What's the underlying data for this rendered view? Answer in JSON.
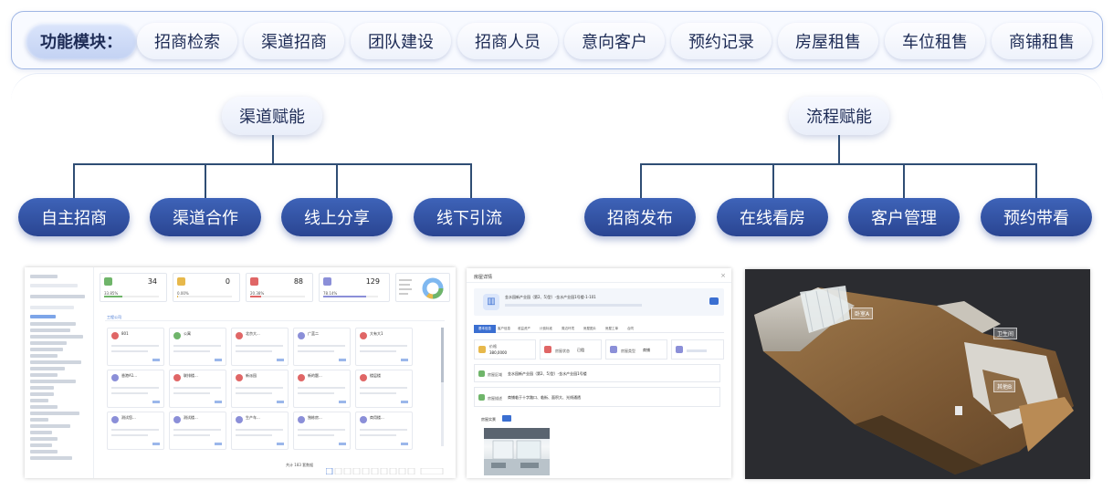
{
  "topbar": {
    "label": "功能模块：",
    "modules": [
      "招商检索",
      "渠道招商",
      "团队建设",
      "招商人员",
      "意向客户",
      "预约记录",
      "房屋租售",
      "车位租售",
      "商铺租售"
    ]
  },
  "groups": [
    {
      "title": "渠道赋能",
      "items": [
        "自主招商",
        "渠道合作",
        "线上分享",
        "线下引流"
      ]
    },
    {
      "title": "流程赋能",
      "items": [
        "招商发布",
        "在线看房",
        "客户管理",
        "预约带看"
      ]
    }
  ],
  "colors": {
    "accent": "#2f4e9e",
    "accent_light": "#3e63b8",
    "border": "#9fb6e4",
    "line": "#2f4d74"
  },
  "screenshot_left": {
    "stats": [
      {
        "value": "34",
        "pct": "33.85%",
        "color": "#6fb56a"
      },
      {
        "value": "0",
        "pct": "0.00%",
        "color": "#e7b84b"
      },
      {
        "value": "88",
        "pct": "20.38%",
        "color": "#e06666"
      },
      {
        "value": "129",
        "pct": "78.14%",
        "color": "#8b8fd8"
      }
    ],
    "section_title": "工程公司",
    "cards": [
      "801",
      "公寓",
      "北京大...",
      "广蓝二",
      "大有大1",
      "香港A1...",
      "联排楼...",
      "新派园",
      "新的题...",
      "楼层楼",
      "测试您...",
      "测试楼...",
      "生产车...",
      "独栋房...",
      "商用楼..."
    ],
    "footer_text": "共计 183 套数据"
  },
  "screenshot_mid": {
    "title": "房屋详情",
    "address": "金水园新产业园（第2、5)型）-金水产业园1号楼-1-101",
    "tabs": [
      "基本信息",
      "客户信息",
      "收益资产",
      "计费标准",
      "周边环境",
      "房屋图片",
      "房屋工单",
      "合同"
    ],
    "fields": [
      {
        "label": "价格",
        "value": "380,0000"
      },
      {
        "label": "房屋状态",
        "value": "已租"
      },
      {
        "label": "房屋类型",
        "value": "商铺"
      }
    ],
    "location_label": "房屋区域",
    "location_value": "金水园新产业园（第2、5)型）-金水产业园1号楼",
    "desc_label": "房屋描述",
    "desc_value": "商铺临于十字路口、临街、面积大、光线通透",
    "photo_label": "房屋实景"
  },
  "screenshot_right": {
    "tags": [
      "卧室A",
      "卫生间",
      "其他B"
    ]
  }
}
